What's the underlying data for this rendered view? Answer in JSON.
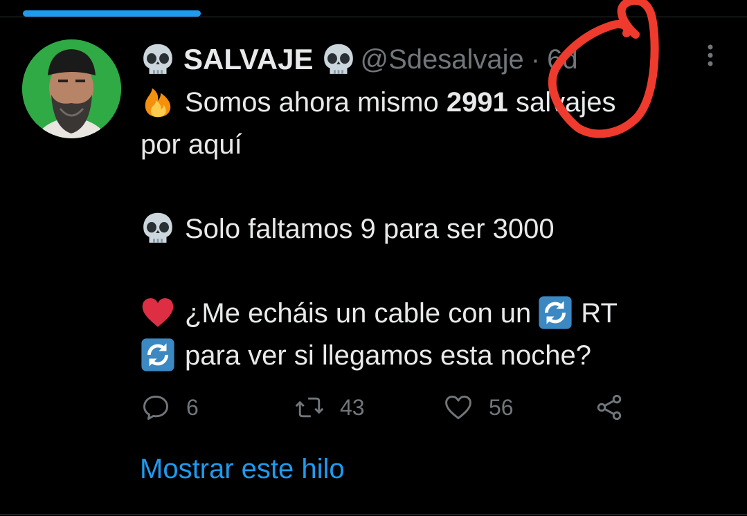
{
  "tweet": {
    "display_name": "SALVAJE",
    "handle": "@Sdesalvaje",
    "separator": "·",
    "timestamp": "6d",
    "lines": {
      "l1_prefix": "Somos ahora mismo ",
      "l1_bold": "2991",
      "l1_suffix": " salvajes",
      "l2": "por aquí",
      "l3": "Solo faltamos 9 para ser 3000",
      "l4_text": "¿Me echáis un cable con un",
      "l4_rt": "RT",
      "l5": "para ver si llegamos esta noche?"
    },
    "emojis": {
      "name_left": "skull-emoji",
      "name_right": "skull-emoji",
      "line1": "fire-emoji",
      "line3": "skull-emoji",
      "line4": "red-heart-emoji",
      "line4_inline": "arrows-counterclockwise-emoji",
      "line5": "arrows-counterclockwise-emoji"
    }
  },
  "actions": {
    "reply_count": "6",
    "retweet_count": "43",
    "like_count": "56"
  },
  "show_thread": "Mostrar este hilo",
  "colors": {
    "background": "#000000",
    "text": "#e7e9ea",
    "muted": "#71767b",
    "accent": "#1d9bf0",
    "annotation": "#ee3b2d"
  }
}
